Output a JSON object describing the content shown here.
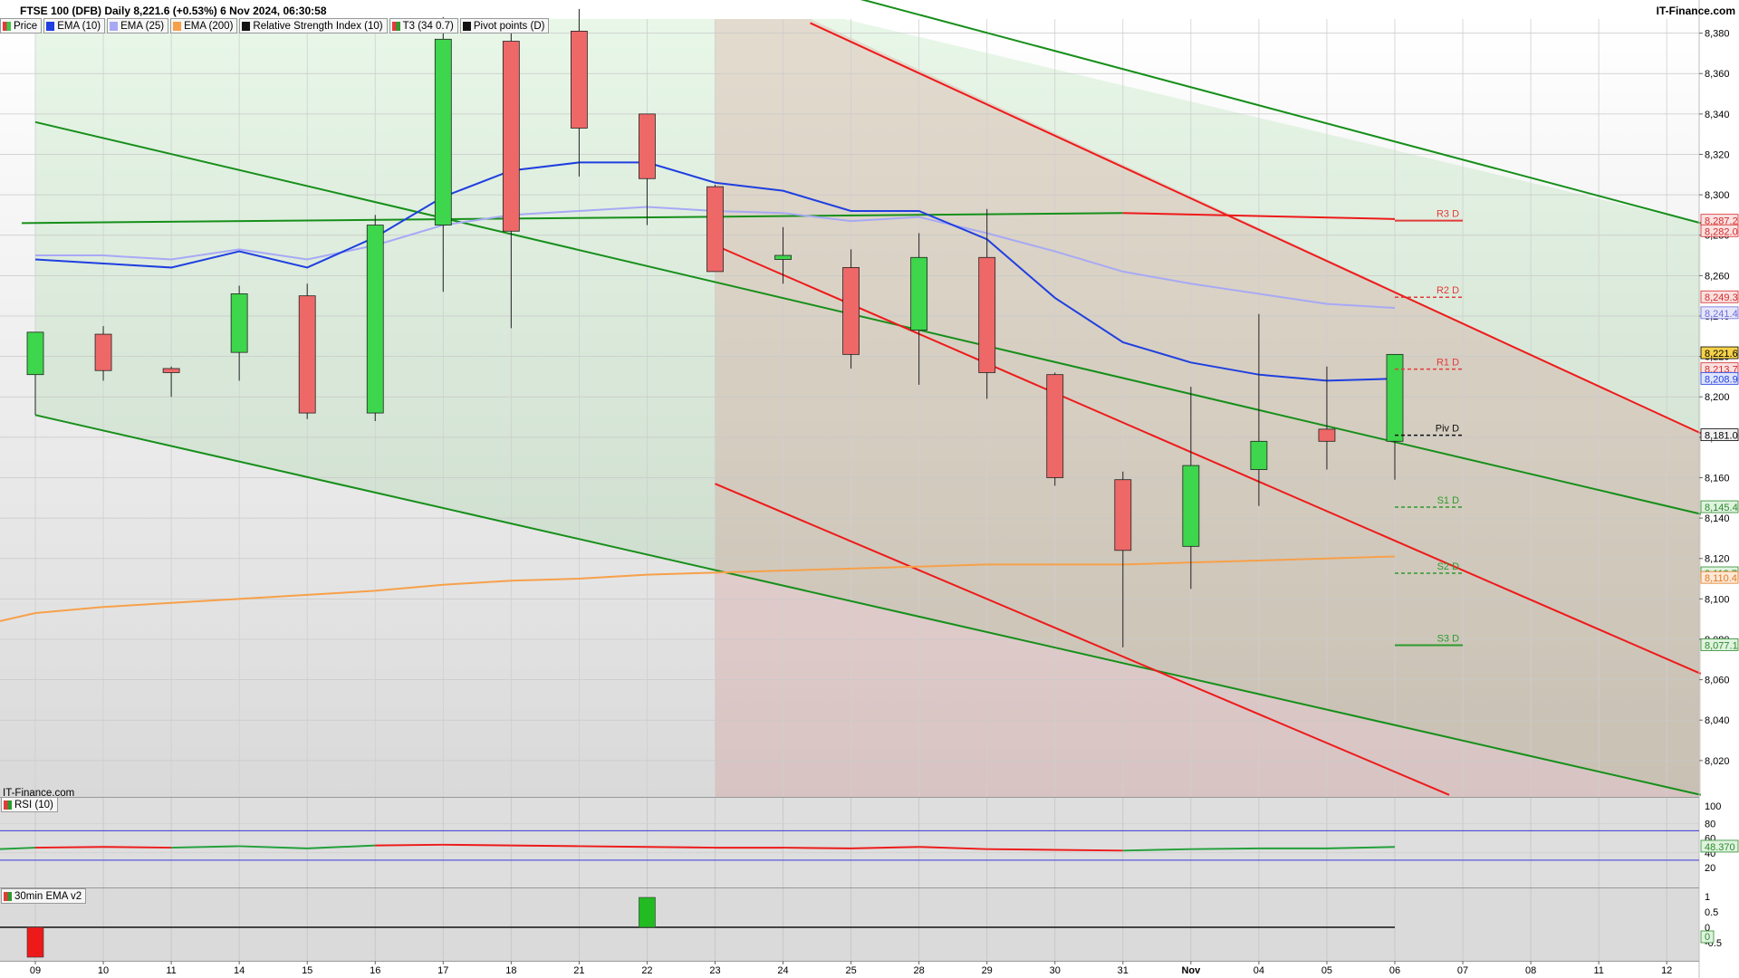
{
  "header": {
    "title": "FTSE 100 (DFB) Daily 8,221.6 (+0.53%) 6 Nov 2024, 06:30:58",
    "brand": "IT-Finance.com",
    "watermark": "IT-Finance.com"
  },
  "legend": [
    {
      "label": "Price",
      "color": "#e23b3b",
      "color2": "#3cc84a"
    },
    {
      "label": "EMA (10)",
      "color": "#1f3fe0"
    },
    {
      "label": "EMA (25)",
      "color": "#a7a9f5"
    },
    {
      "label": "EMA (200)",
      "color": "#f7a04a"
    },
    {
      "label": "Relative Strength Index (10)",
      "color": "#111111"
    },
    {
      "label": "T3 (34 0.7)",
      "color": "#e23b3b",
      "color2": "#2d9a2d"
    },
    {
      "label": "Pivot points (D)",
      "color": "#111111"
    }
  ],
  "rsi_panel": {
    "label": "RSI (10)"
  },
  "ema_panel": {
    "label": "30min EMA v2"
  },
  "colors": {
    "bull": "#3dd64c",
    "bear": "#ee6868",
    "ema10": "#1f3fe0",
    "ema25": "#a7a9f5",
    "ema200": "#f7a04a",
    "green_channel": "#168f1a",
    "red_channel": "#ee1a1a"
  },
  "chart_data": {
    "type": "candlestick",
    "x_labels": [
      "09",
      "10",
      "11",
      "14",
      "15",
      "16",
      "17",
      "18",
      "21",
      "22",
      "23",
      "24",
      "25",
      "28",
      "29",
      "30",
      "31",
      "Nov",
      "04",
      "05",
      "06",
      "07",
      "08",
      "11",
      "12"
    ],
    "y_ticks": [
      "8,020",
      "8,040",
      "8,060",
      "8,080",
      "8,100",
      "8,120",
      "8,140",
      "8,160",
      "8,180",
      "8,200",
      "8,220",
      "8,240",
      "8,260",
      "8,280",
      "8,300",
      "8,320",
      "8,340",
      "8,360",
      "8,380"
    ],
    "ylim": [
      8002,
      8387
    ],
    "candles": [
      {
        "o": 8211,
        "h": 8216,
        "l": 8191,
        "c": 8232
      },
      {
        "o": 8231,
        "h": 8235,
        "l": 8208,
        "c": 8213
      },
      {
        "o": 8214,
        "h": 8215,
        "l": 8200,
        "c": 8212
      },
      {
        "o": 8222,
        "h": 8255,
        "l": 8208,
        "c": 8251
      },
      {
        "o": 8250,
        "h": 8256,
        "l": 8189,
        "c": 8192
      },
      {
        "o": 8192,
        "h": 8290,
        "l": 8188,
        "c": 8285
      },
      {
        "o": 8285,
        "h": 8388,
        "l": 8252,
        "c": 8377
      },
      {
        "o": 8376,
        "h": 8385,
        "l": 8234,
        "c": 8282
      },
      {
        "o": 8381,
        "h": 8392,
        "l": 8309,
        "c": 8333
      },
      {
        "o": 8340,
        "h": 8337,
        "l": 8285,
        "c": 8308
      },
      {
        "o": 8304,
        "h": 8305,
        "l": 8262,
        "c": 8262
      },
      {
        "o": 8268,
        "h": 8284,
        "l": 8256,
        "c": 8270
      },
      {
        "o": 8264,
        "h": 8273,
        "l": 8214,
        "c": 8221
      },
      {
        "o": 8233,
        "h": 8281,
        "l": 8206,
        "c": 8269
      },
      {
        "o": 8269,
        "h": 8293,
        "l": 8199,
        "c": 8212
      },
      {
        "o": 8211,
        "h": 8212,
        "l": 8156,
        "c": 8160
      },
      {
        "o": 8159,
        "h": 8163,
        "l": 8076,
        "c": 8124
      },
      {
        "o": 8126,
        "h": 8205,
        "l": 8105,
        "c": 8166
      },
      {
        "o": 8164,
        "h": 8241,
        "l": 8146,
        "c": 8178
      },
      {
        "o": 8184,
        "h": 8215,
        "l": 8164,
        "c": 8178
      },
      {
        "o": 8178,
        "h": 8221,
        "l": 8159,
        "c": 8221
      }
    ],
    "ema10": [
      8268,
      8266,
      8264,
      8272,
      8264,
      8279,
      8299,
      8312,
      8316,
      8316,
      8306,
      8302,
      8292,
      8292,
      8278,
      8249,
      8227,
      8217,
      8211,
      8208,
      8209
    ],
    "ema25": [
      8270,
      8270,
      8268,
      8273,
      8268,
      8275,
      8285,
      8290,
      8292,
      8294,
      8292,
      8291,
      8287,
      8289,
      8281,
      8272,
      8262,
      8256,
      8251,
      8246,
      8244
    ],
    "ema200": [
      8093,
      8096,
      8098,
      8100,
      8102,
      8104,
      8107,
      8109,
      8110,
      8112,
      8113,
      8114,
      8115,
      8116,
      8117,
      8117,
      8117,
      8118,
      8119,
      8120,
      8121
    ],
    "t3_flat": {
      "x0": -0.2,
      "y0": 8286,
      "x1": 16.0,
      "y1": 8291,
      "x2": 20.0,
      "y2": 8289
    },
    "pivots": [
      {
        "label": "R3 D",
        "value": 8287.2,
        "style": "solid",
        "color": "#e23b3b"
      },
      {
        "label": "R2 D",
        "value": 8249.3,
        "style": "dashed",
        "color": "#e23b3b"
      },
      {
        "label": "R1 D",
        "value": 8213.7,
        "style": "dashed",
        "color": "#e23b3b"
      },
      {
        "label": "Piv D",
        "value": 8181.0,
        "style": "dashed",
        "color": "#111111"
      },
      {
        "label": "S1 D",
        "value": 8145.4,
        "style": "dashed",
        "color": "#2d9a2d"
      },
      {
        "label": "S2 D",
        "value": 8112.7,
        "style": "dashed",
        "color": "#2d9a2d"
      },
      {
        "label": "S3 D",
        "value": 8077.1,
        "style": "solid",
        "color": "#2d9a2d"
      }
    ],
    "price_tags": [
      {
        "text": "8,287.2",
        "value": 8287.2,
        "bg": "#fbe1e1",
        "fg": "#d32a2a"
      },
      {
        "text": "8,282.0",
        "value": 8282.0,
        "bg": "#fbe1e1",
        "fg": "#d32a2a"
      },
      {
        "text": "8,249.3",
        "value": 8249.3,
        "bg": "#fbe1e1",
        "fg": "#d32a2a"
      },
      {
        "text": "8,241.4",
        "value": 8241.4,
        "bg": "#e7e7fb",
        "fg": "#6a6cd8"
      },
      {
        "text": "8,221.6",
        "value": 8221.6,
        "bg": "#f6d24a",
        "fg": "#000000"
      },
      {
        "text": "8,213.7",
        "value": 8213.7,
        "bg": "#fbe1e1",
        "fg": "#d32a2a"
      },
      {
        "text": "8,208.9",
        "value": 8208.9,
        "bg": "#dfe4fb",
        "fg": "#1f3fe0"
      },
      {
        "text": "8,181.0",
        "value": 8181.0,
        "bg": "#f2f2f2",
        "fg": "#000000"
      },
      {
        "text": "8,145.4",
        "value": 8145.4,
        "bg": "#dff3df",
        "fg": "#2d8a2d"
      },
      {
        "text": "8,112.7",
        "value": 8112.7,
        "bg": "#dff3df",
        "fg": "#2d8a2d"
      },
      {
        "text": "8,110.4",
        "value": 8110.4,
        "bg": "#fde9d8",
        "fg": "#e07a1e"
      },
      {
        "text": "8,077.1",
        "value": 8077.1,
        "bg": "#dff3df",
        "fg": "#2d8a2d"
      }
    ],
    "green_channel": {
      "upper": {
        "x0": 11.9,
        "y0": 8399,
        "x1": 24.5,
        "y1": 8286
      },
      "middle": {
        "x0": -0.2,
        "y0": 8281,
        "x1": 24.5,
        "y1": 8142
      },
      "lower": {
        "x0": -0.2,
        "y0": 8191,
        "x1": 24.5,
        "y1": 8003
      },
      "mid_start": {
        "x0": 0.0,
        "y0": 8336
      }
    },
    "red_channel": {
      "upper": {
        "x0": 11.4,
        "y0": 8385,
        "x1": 24.5,
        "y1": 8182
      },
      "middle": {
        "x0": 10.0,
        "y0": 8275,
        "x1": 24.5,
        "y1": 8063
      },
      "lower": {
        "x0": 10.0,
        "y0": 8157,
        "x1": 20.8,
        "y1": 8003
      }
    },
    "rsi": {
      "ticks": [
        "100",
        "80",
        "60",
        "40",
        "20"
      ],
      "ylim": [
        20,
        100
      ],
      "levels": [
        70,
        30
      ],
      "value_tag": "48.370",
      "values": [
        47,
        48,
        47,
        49,
        46,
        50,
        51,
        50,
        49,
        48,
        47,
        47,
        46,
        48,
        45,
        44,
        43,
        45,
        46,
        46,
        48
      ]
    },
    "ema_hist": {
      "ticks": [
        "1",
        "0.5",
        "0",
        "-0.5"
      ],
      "ylim": [
        -1,
        1
      ],
      "value_tag": "0",
      "bars": [
        {
          "i": 0,
          "v": -1,
          "color": "#ee1a1a"
        },
        {
          "i": 9,
          "v": 1,
          "color": "#22bb22"
        }
      ]
    }
  }
}
